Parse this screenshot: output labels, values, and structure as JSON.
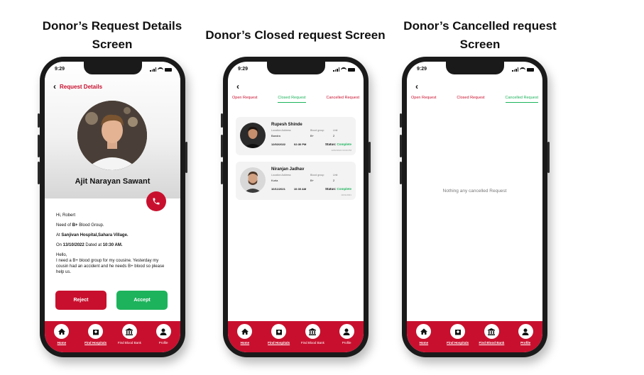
{
  "titles": {
    "col1_line1": "Donor’s Request Details",
    "col1_line2": "Screen",
    "col2": "Donor’s Closed request Screen",
    "col3_line1": "Donor’s Cancelled request",
    "col3_line2": "Screen"
  },
  "status_time": "9:29",
  "details": {
    "header": "Request Details",
    "donor_name": "Ajit Narayan Sawant",
    "greeting": "Hi, Robert",
    "need_pre": "Need of ",
    "need_bold": "B+",
    "need_post": " Blood Group.",
    "at_pre": "At ",
    "at_bold": "Sanjivan Hospital,Sahara Village.",
    "on_pre": "On ",
    "on_date": "13/10/2022",
    "on_mid": " Dated at ",
    "on_time": "10:30 AM.",
    "body_1": "Hello,",
    "body_2": "I need a B+ blood group for my cousine. Yesterday my cousin had an accident and he needs B+ blood so please help us.",
    "reject": "Reject",
    "accept": "Accept"
  },
  "tabs": [
    "Open Request",
    "Closed Request",
    "Cancelled Request"
  ],
  "cards": [
    {
      "name": "Rupesh Shinde",
      "label_address": "Location Address",
      "label_group": "Blood group",
      "label_unit": "Unit",
      "address": "Bandra",
      "group": "B+",
      "unit": "2",
      "date": "12/02/2022",
      "time": "02:30 PM",
      "status_label": "Status:",
      "status": "Complete",
      "tiny": "12/02/2022     03:00 PM"
    },
    {
      "name": "Niranjan Jadhav",
      "label_address": "Location Address",
      "label_group": "Blood group",
      "label_unit": "Unit",
      "address": "Kurla",
      "group": "B+",
      "unit": "2",
      "date": "10/11/2021",
      "time": "10:30 AM",
      "status_label": "Status:",
      "status": "Complete",
      "tiny": "10/11/2021"
    }
  ],
  "empty_message": "Nothing any cancelled Request",
  "nav": [
    "Home",
    "Find Hospitals",
    "Find Blood Bank",
    "Profile"
  ],
  "colors": {
    "brand_red": "#c8102e",
    "accent_green": "#1db35c"
  }
}
